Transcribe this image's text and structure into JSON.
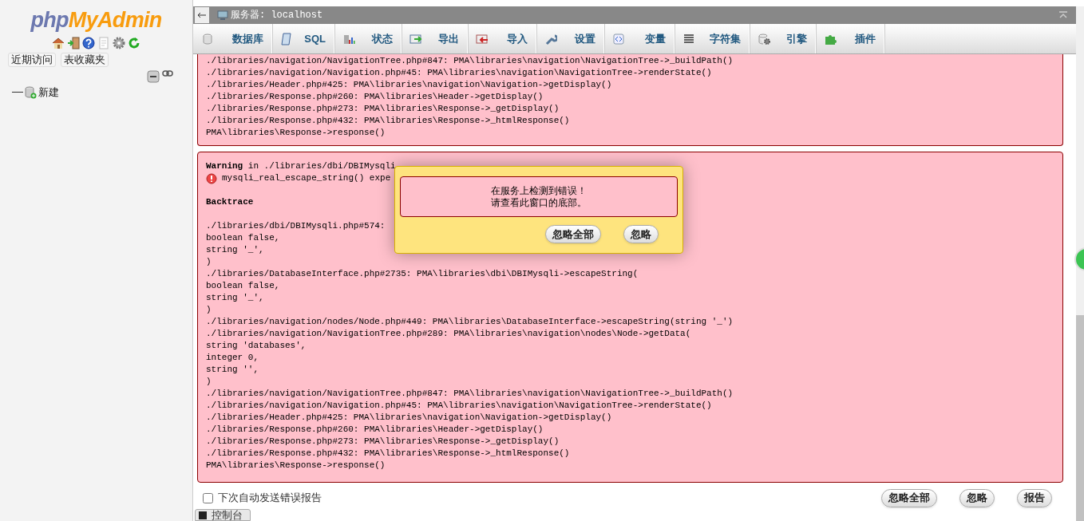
{
  "sidebar": {
    "logo": [
      "php",
      "MyAdmin"
    ],
    "tabs": [
      {
        "label": "近期访问"
      },
      {
        "label": "表收藏夹"
      }
    ],
    "tree": [
      {
        "label": "新建"
      }
    ]
  },
  "topbar": {
    "server": "服务器: localhost"
  },
  "menu": [
    {
      "label": "数据库"
    },
    {
      "label": "SQL"
    },
    {
      "label": "状态"
    },
    {
      "label": "导出"
    },
    {
      "label": "导入"
    },
    {
      "label": "设置"
    },
    {
      "label": "变量"
    },
    {
      "label": "字符集"
    },
    {
      "label": "引擎"
    },
    {
      "label": "插件"
    }
  ],
  "errors": [
    {
      "lines": [
        "./libraries/navigation/NavigationTree.php#847: PMA\\libraries\\navigation\\NavigationTree->_buildPath()",
        "./libraries/navigation/Navigation.php#45: PMA\\libraries\\navigation\\NavigationTree->renderState()",
        "./libraries/Header.php#425: PMA\\libraries\\navigation\\Navigation->getDisplay()",
        "./libraries/Response.php#260: PMA\\libraries\\Header->getDisplay()",
        "./libraries/Response.php#273: PMA\\libraries\\Response->_getDisplay()",
        "./libraries/Response.php#432: PMA\\libraries\\Response->_htmlResponse()",
        "PMA\\libraries\\Response->response()"
      ]
    },
    {
      "warning": "**Warning** in ./libraries/dbi/DBIMysqli",
      "message": "mysqli_real_escape_string() expe",
      "heading": "Backtrace",
      "lines": [
        "./libraries/dbi/DBIMysqli.php#574:",
        "boolean false,",
        "string '_',",
        ")",
        "./libraries/DatabaseInterface.php#2735: PMA\\libraries\\dbi\\DBIMysqli->escapeString(",
        "boolean false,",
        "string '_',",
        ")",
        "./libraries/navigation/nodes/Node.php#449: PMA\\libraries\\DatabaseInterface->escapeString(string '_')",
        "./libraries/navigation/NavigationTree.php#289: PMA\\libraries\\navigation\\nodes\\Node->getData(",
        "string 'databases',",
        "integer 0,",
        "string '',",
        ")",
        "./libraries/navigation/NavigationTree.php#847: PMA\\libraries\\navigation\\NavigationTree->_buildPath()",
        "./libraries/navigation/Navigation.php#45: PMA\\libraries\\navigation\\NavigationTree->renderState()",
        "./libraries/Header.php#425: PMA\\libraries\\navigation\\Navigation->getDisplay()",
        "./libraries/Response.php#260: PMA\\libraries\\Header->getDisplay()",
        "./libraries/Response.php#273: PMA\\libraries\\Response->_getDisplay()",
        "./libraries/Response.php#432: PMA\\libraries\\Response->_htmlResponse()",
        "PMA\\libraries\\Response->response()"
      ]
    }
  ],
  "dialog": {
    "message": [
      "在服务上检测到错误！",
      "请查看此窗口的底部。"
    ],
    "buttons": [
      "忽略全部",
      "忽略"
    ]
  },
  "footer": {
    "auto_send": {
      "label": "下次自动发送错误报告",
      "checked": false
    },
    "buttons": [
      "忽略全部",
      "忽略",
      "报告"
    ]
  },
  "console": {
    "label": "控制台"
  }
}
